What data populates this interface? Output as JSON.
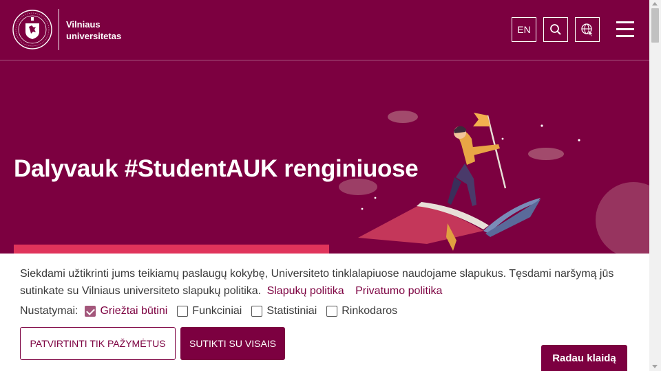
{
  "header": {
    "logo_line1": "Vilniaus",
    "logo_line2": "universitetas",
    "lang_button": "EN",
    "search_icon": "search-icon",
    "accessibility_icon": "globe-cursor-icon",
    "menu_icon": "hamburger-menu-icon"
  },
  "hero": {
    "title": "Dalyvauk #StudentAUK renginiuose"
  },
  "cookie": {
    "text": "Siekdami užtikrinti jums teikiamų paslaugų kokybę, Universiteto tinklalapiuose naudojame slapukus. Tęsdami naršymą jūs sutinkate su Vilniaus universiteto slapukų politika.",
    "link_cookies": "Slapukų politika",
    "link_privacy": "Privatumo politika",
    "settings_label": "Nustatymai:",
    "options": [
      {
        "label": "Griežtai būtini",
        "checked": true
      },
      {
        "label": "Funkciniai",
        "checked": false
      },
      {
        "label": "Statistiniai",
        "checked": false
      },
      {
        "label": "Rinkodaros",
        "checked": false
      }
    ],
    "btn_confirm_selected": "PATVIRTINTI TIK PAŽYMĖTUS",
    "btn_accept_all": "SUTIKTI SU VISAIS"
  },
  "report_button": "Radau klaidą",
  "colors": {
    "brand": "#7c0040",
    "accent": "#e0345b",
    "checkbox_checked": "#a3577b"
  }
}
